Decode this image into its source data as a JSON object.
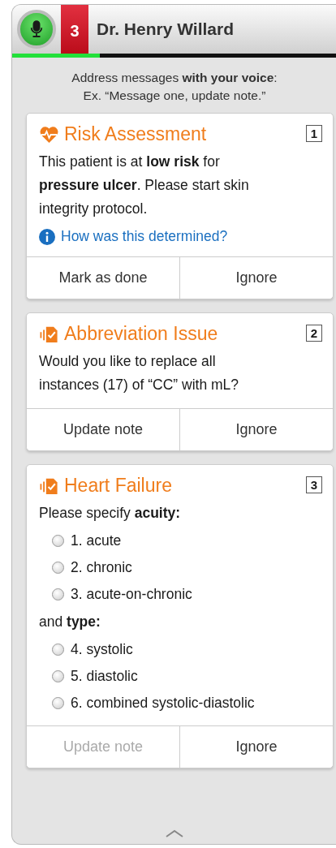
{
  "header": {
    "badge": "3",
    "name": "Dr. Henry Willard",
    "progress": {
      "level": 0.27
    }
  },
  "instructions": [
    "Address messages **with your voice**:",
    "Ex. “Message one, update note.”"
  ],
  "cards": [
    {
      "kind": "risk",
      "title": "Risk Assessment",
      "number": "1",
      "body": [
        {
          "kind": "text",
          "text": "This patient is at **low risk** for **pressure ulcer**. Please start skin integrity protocol."
        },
        {
          "kind": "link",
          "text": "How was this determined?"
        }
      ],
      "buttons": [
        {
          "label": "Mark as done",
          "disabled": false
        },
        {
          "label": "Ignore",
          "disabled": false
        }
      ]
    },
    {
      "kind": "coding",
      "title": "Abbreviation Issue",
      "number": "2",
      "body": [
        {
          "kind": "text",
          "text": "Would you like to replace all instances (17) of “CC” with mL?"
        }
      ],
      "buttons": [
        {
          "label": "Update note",
          "disabled": false
        },
        {
          "label": "Ignore",
          "disabled": false
        }
      ]
    },
    {
      "kind": "coding",
      "title": "Heart Failure",
      "number": "3",
      "body": [
        {
          "kind": "text",
          "text": "Please specify **acuity:**"
        },
        {
          "kind": "option",
          "text": "1. acute",
          "selected": false
        },
        {
          "kind": "option",
          "text": "2. chronic",
          "selected": false
        },
        {
          "kind": "option",
          "text": "3. acute-on-chronic",
          "selected": false
        },
        {
          "kind": "text",
          "text": "and **type:**"
        },
        {
          "kind": "option",
          "text": "4. systolic",
          "selected": false
        },
        {
          "kind": "option",
          "text": "5. diastolic",
          "selected": false
        },
        {
          "kind": "option",
          "text": "6. combined systolic-diastolic",
          "selected": false
        }
      ],
      "buttons": [
        {
          "label": "Update note",
          "disabled": true
        },
        {
          "label": "Ignore",
          "disabled": false
        }
      ]
    }
  ]
}
